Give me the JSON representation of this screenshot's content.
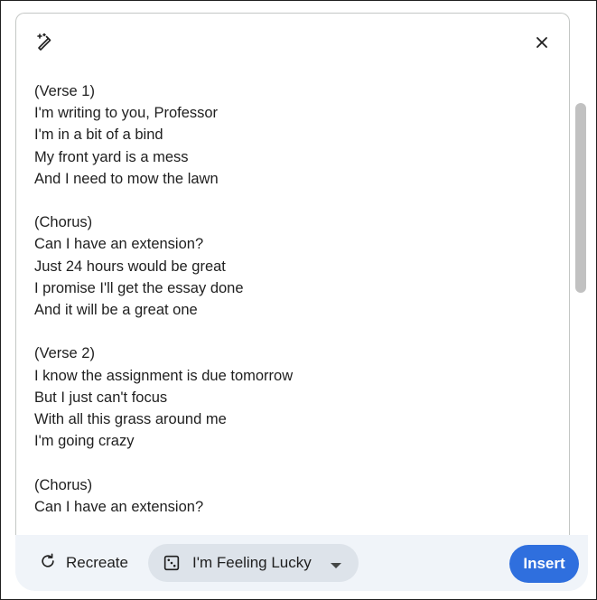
{
  "lyrics": "(Verse 1)\nI'm writing to you, Professor\nI'm in a bit of a bind\nMy front yard is a mess\nAnd I need to mow the lawn\n\n(Chorus)\nCan I have an extension?\nJust 24 hours would be great\nI promise I'll get the essay done\nAnd it will be a great one\n\n(Verse 2)\nI know the assignment is due tomorrow\nBut I just can't focus\nWith all this grass around me\nI'm going crazy\n\n(Chorus)\nCan I have an extension?",
  "actions": {
    "recreate_label": "Recreate",
    "lucky_label": "I'm Feeling Lucky",
    "insert_label": "Insert"
  },
  "icons": {
    "magic": "magic-wand-icon",
    "close": "close-icon",
    "recreate": "refresh-icon",
    "lucky": "dice-icon",
    "dropdown": "caret-down-icon"
  },
  "colors": {
    "accent": "#2f6fde",
    "chip_bg": "#dde3ea",
    "bar_bg": "#f0f4f9",
    "text": "#1f1f1f"
  }
}
